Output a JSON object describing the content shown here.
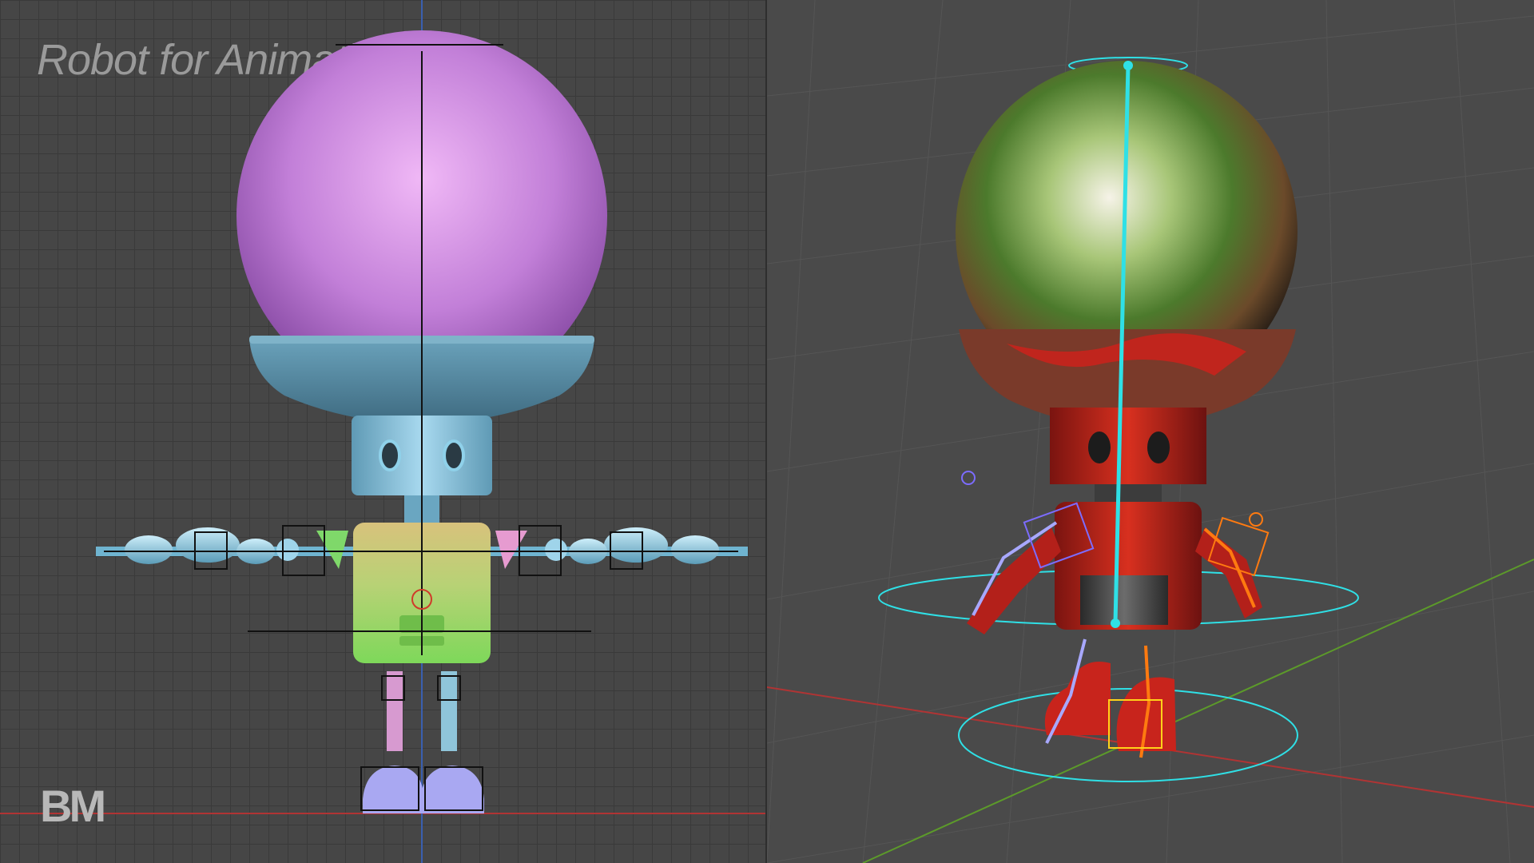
{
  "left_viewport": {
    "title": "Robot for Animation",
    "logo": "BM"
  },
  "right_viewport": {},
  "colors": {
    "head_purple": "#c27fd8",
    "head_base_blue": "#5e8fa6",
    "body_blue": "#8bc3db",
    "torso_yellow": "#c9c27a",
    "torso_green": "#9bdd6a",
    "shoulder_green": "#7fd86a",
    "shoulder_pink": "#e69bd0",
    "foot_lavender": "#a9a8f2",
    "robot_red": "#c8241c",
    "bone_cyan": "#2fe0e6",
    "bone_orange": "#ff7a10",
    "bone_lavender": "#a8a8ff",
    "axis_red": "#b03434",
    "axis_green": "#5c9a2a",
    "grid_line": "#3a3a3a"
  },
  "icons": {
    "logo": "bm-logo",
    "armature": "armature-bones"
  }
}
